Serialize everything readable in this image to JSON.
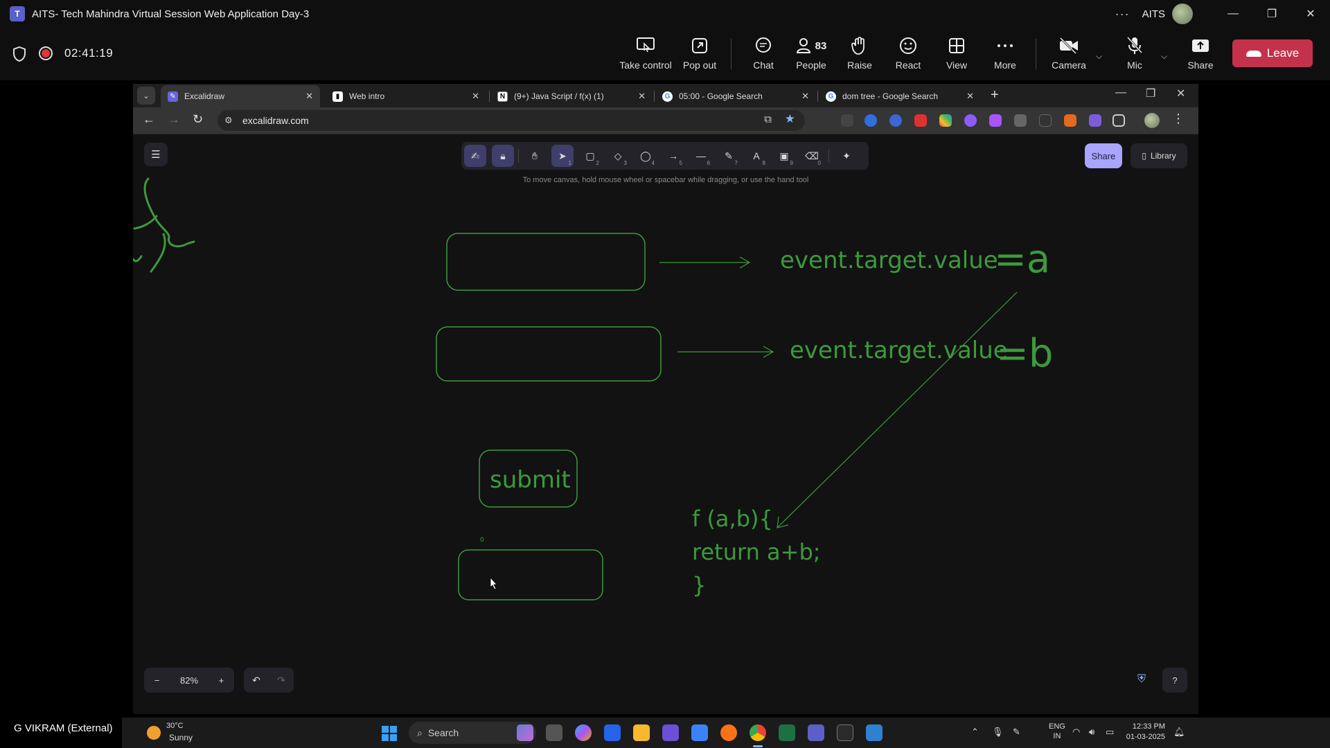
{
  "window": {
    "title": "AITS- Tech Mahindra Virtual Session Web Application Day-3",
    "org": "AITS",
    "more_glyph": "···"
  },
  "meeting": {
    "timer": "02:41:19",
    "buttons": {
      "take_control": "Take control",
      "pop_out": "Pop out",
      "chat": "Chat",
      "people": "People",
      "people_count": "83",
      "raise": "Raise",
      "react": "React",
      "view": "View",
      "more": "More",
      "camera": "Camera",
      "mic": "Mic",
      "share": "Share",
      "leave": "Leave"
    }
  },
  "browser": {
    "tabs": [
      {
        "title": "Excalidraw",
        "active": true
      },
      {
        "title": "Web intro",
        "active": false
      },
      {
        "title": "(9+) Java Script / f(x) (1)",
        "active": false
      },
      {
        "title": "05:00 - Google Search",
        "active": false
      },
      {
        "title": "dom tree - Google Search",
        "active": false
      }
    ],
    "url": "excalidraw.com"
  },
  "excalidraw": {
    "hint": "To move canvas, hold mouse wheel or spacebar while dragging, or use the hand tool",
    "tool_keys": [
      "1",
      "2",
      "3",
      "4",
      "5",
      "6",
      "7",
      "8",
      "9",
      "0"
    ],
    "share_label": "Share",
    "library_label": "Library",
    "zoom": "82%",
    "drawing_text": {
      "line1": "event.target.value",
      "eq_a": "=a",
      "line2": "event.target.value",
      "eq_b": "=b",
      "submit": "submit",
      "small_zero": "0",
      "code1": "f (a,b){",
      "code2": "return a+b;",
      "code3": "}"
    },
    "colors": {
      "stroke": "#3c9a3c",
      "accent": "#a8a5ff"
    }
  },
  "participant": "G VIKRAM (External)",
  "taskbar": {
    "weather_temp": "30°C",
    "weather_cond": "Sunny",
    "search": "Search",
    "lang1": "ENG",
    "lang2": "IN",
    "time": "12:33 PM",
    "date": "01-03-2025"
  }
}
